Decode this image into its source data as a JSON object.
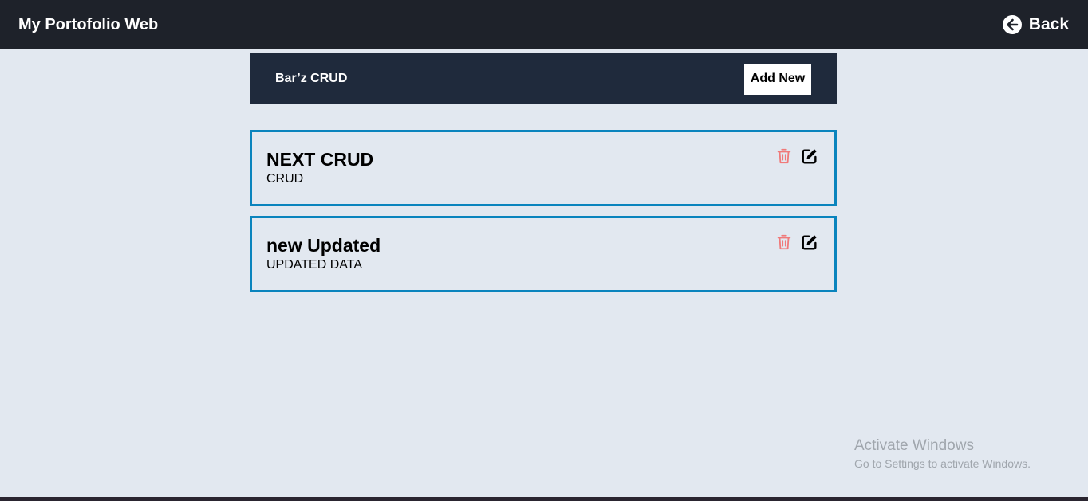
{
  "navbar": {
    "brand": "My Portofolio Web",
    "back_label": "Back",
    "back_icon": "arrow-left-circle-icon"
  },
  "crud_header": {
    "title": "Bar’z CRUD",
    "add_label": "Add New"
  },
  "items": [
    {
      "title": "NEXT CRUD",
      "description": "CRUD",
      "delete_icon": "trash-icon",
      "edit_icon": "edit-icon"
    },
    {
      "title": "new Updated",
      "description": "UPDATED DATA",
      "delete_icon": "trash-icon",
      "edit_icon": "edit-icon"
    }
  ],
  "watermark": {
    "line1": "Activate Windows",
    "line2": "Go to Settings to activate Windows."
  },
  "colors": {
    "navbar_bg": "#1e222a",
    "page_bg": "#e2e8f0",
    "crud_header_bg": "#1f2a3c",
    "card_border": "#0a84bd",
    "delete_icon": "#f07a7a"
  }
}
